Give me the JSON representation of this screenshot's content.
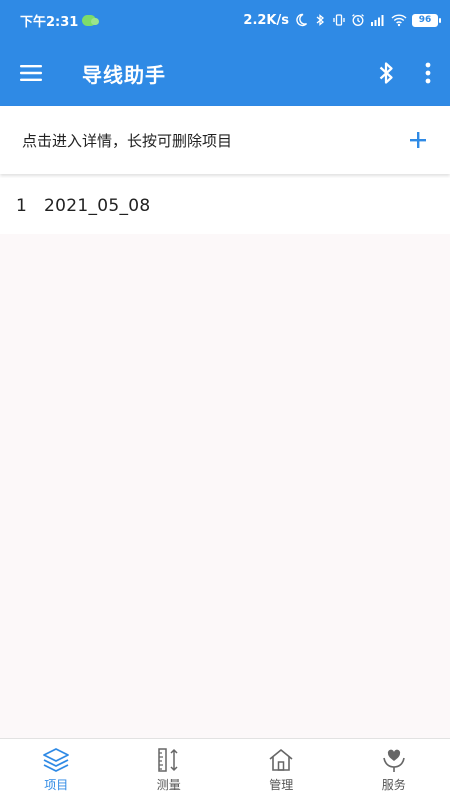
{
  "status_bar": {
    "time": "下午2:31",
    "speed": "2.2K/s",
    "battery": "96"
  },
  "app_bar": {
    "title": "导线助手"
  },
  "hint": {
    "text": "点击进入详情，长按可删除项目"
  },
  "projects": [
    {
      "index": "1",
      "name": "2021_05_08"
    }
  ],
  "bottom_nav": {
    "items": [
      {
        "label": "项目",
        "icon": "layers-icon",
        "active": true
      },
      {
        "label": "测量",
        "icon": "ruler-icon",
        "active": false
      },
      {
        "label": "管理",
        "icon": "home-icon",
        "active": false
      },
      {
        "label": "服务",
        "icon": "heart-hand-icon",
        "active": false
      }
    ]
  },
  "colors": {
    "primary": "#2f8ae5",
    "background": "#fcf8f9"
  }
}
